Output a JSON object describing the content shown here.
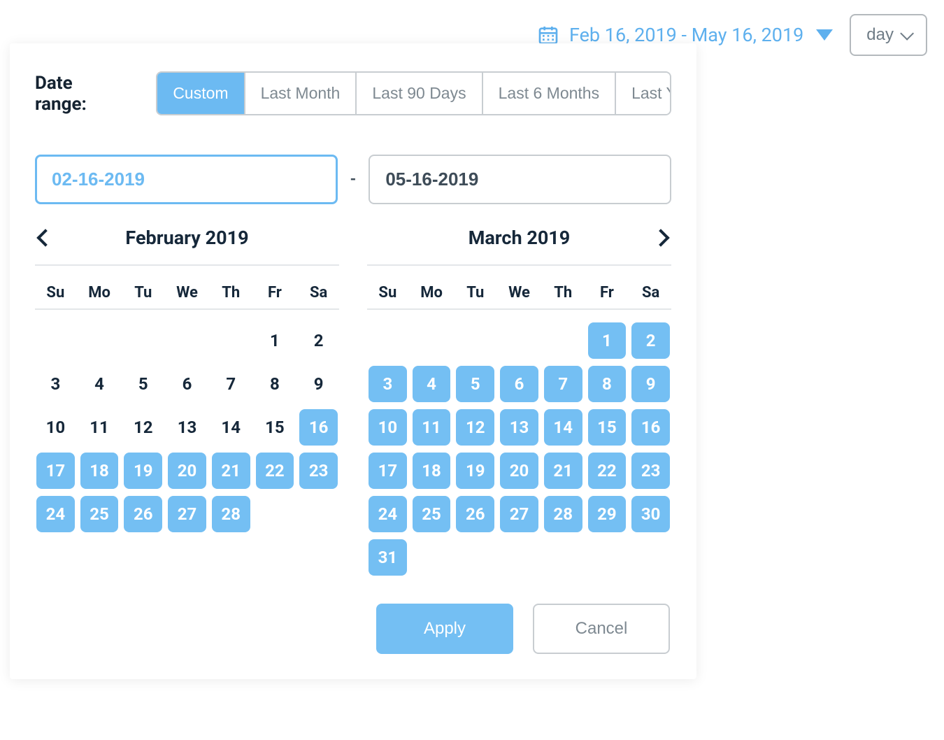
{
  "header": {
    "date_range_display": "Feb 16, 2019 - May 16, 2019",
    "granularity_label": "day"
  },
  "popover": {
    "label": "Date range:",
    "presets": [
      {
        "label": "Custom",
        "active": true
      },
      {
        "label": "Last Month",
        "active": false
      },
      {
        "label": "Last 90 Days",
        "active": false
      },
      {
        "label": "Last 6 Months",
        "active": false
      },
      {
        "label": "Last Year",
        "active": false
      }
    ],
    "start_input": "02-16-2019",
    "end_input": "05-16-2019",
    "dow": [
      "Su",
      "Mo",
      "Tu",
      "We",
      "Th",
      "Fr",
      "Sa"
    ],
    "months": [
      {
        "title": "February 2019",
        "has_prev": true,
        "has_next": false,
        "weeks": [
          [
            null,
            null,
            null,
            null,
            null,
            {
              "d": 1,
              "r": false
            },
            {
              "d": 2,
              "r": false
            }
          ],
          [
            {
              "d": 3,
              "r": false
            },
            {
              "d": 4,
              "r": false
            },
            {
              "d": 5,
              "r": false
            },
            {
              "d": 6,
              "r": false
            },
            {
              "d": 7,
              "r": false
            },
            {
              "d": 8,
              "r": false
            },
            {
              "d": 9,
              "r": false
            }
          ],
          [
            {
              "d": 10,
              "r": false
            },
            {
              "d": 11,
              "r": false
            },
            {
              "d": 12,
              "r": false
            },
            {
              "d": 13,
              "r": false
            },
            {
              "d": 14,
              "r": false
            },
            {
              "d": 15,
              "r": false
            },
            {
              "d": 16,
              "r": true
            }
          ],
          [
            {
              "d": 17,
              "r": true
            },
            {
              "d": 18,
              "r": true
            },
            {
              "d": 19,
              "r": true
            },
            {
              "d": 20,
              "r": true
            },
            {
              "d": 21,
              "r": true
            },
            {
              "d": 22,
              "r": true
            },
            {
              "d": 23,
              "r": true
            }
          ],
          [
            {
              "d": 24,
              "r": true
            },
            {
              "d": 25,
              "r": true
            },
            {
              "d": 26,
              "r": true
            },
            {
              "d": 27,
              "r": true
            },
            {
              "d": 28,
              "r": true
            },
            null,
            null
          ]
        ]
      },
      {
        "title": "March 2019",
        "has_prev": false,
        "has_next": true,
        "weeks": [
          [
            null,
            null,
            null,
            null,
            null,
            {
              "d": 1,
              "r": true
            },
            {
              "d": 2,
              "r": true
            }
          ],
          [
            {
              "d": 3,
              "r": true
            },
            {
              "d": 4,
              "r": true
            },
            {
              "d": 5,
              "r": true
            },
            {
              "d": 6,
              "r": true
            },
            {
              "d": 7,
              "r": true
            },
            {
              "d": 8,
              "r": true
            },
            {
              "d": 9,
              "r": true
            }
          ],
          [
            {
              "d": 10,
              "r": true
            },
            {
              "d": 11,
              "r": true
            },
            {
              "d": 12,
              "r": true
            },
            {
              "d": 13,
              "r": true
            },
            {
              "d": 14,
              "r": true
            },
            {
              "d": 15,
              "r": true
            },
            {
              "d": 16,
              "r": true
            }
          ],
          [
            {
              "d": 17,
              "r": true
            },
            {
              "d": 18,
              "r": true
            },
            {
              "d": 19,
              "r": true
            },
            {
              "d": 20,
              "r": true
            },
            {
              "d": 21,
              "r": true
            },
            {
              "d": 22,
              "r": true
            },
            {
              "d": 23,
              "r": true
            }
          ],
          [
            {
              "d": 24,
              "r": true
            },
            {
              "d": 25,
              "r": true
            },
            {
              "d": 26,
              "r": true
            },
            {
              "d": 27,
              "r": true
            },
            {
              "d": 28,
              "r": true
            },
            {
              "d": 29,
              "r": true
            },
            {
              "d": 30,
              "r": true
            }
          ],
          [
            {
              "d": 31,
              "r": true
            },
            null,
            null,
            null,
            null,
            null,
            null
          ]
        ]
      }
    ],
    "actions": {
      "apply": "Apply",
      "cancel": "Cancel"
    }
  }
}
